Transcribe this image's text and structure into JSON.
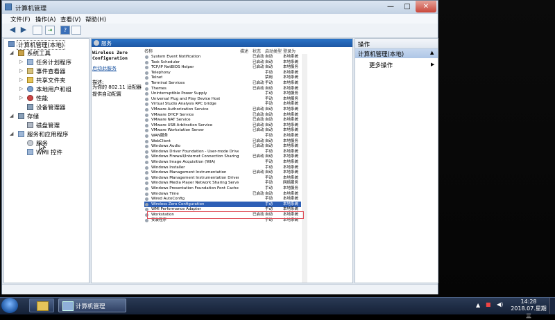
{
  "window": {
    "title": "计算机管理",
    "minimize": "—",
    "maximize": "□",
    "close": "✕"
  },
  "menu": [
    "文件(F)",
    "操作(A)",
    "查看(V)",
    "帮助(H)"
  ],
  "tree": {
    "root": "计算机管理(本地)",
    "system_tools": "系统工具",
    "items": [
      "任务计划程序",
      "事件查看器",
      "共享文件夹",
      "本地用户和组",
      "性能",
      "设备管理器"
    ],
    "storage": "存储",
    "disk": "磁盘管理",
    "services_apps": "服务和应用程序",
    "services": "服务",
    "wmi": "WMI 控件"
  },
  "center": {
    "header": "服务",
    "service_name": "Wireless Zero Configuration",
    "stop_link": "启动此服务",
    "desc_label": "描述:",
    "desc_text": "为你的 802.11 适配器提供自动配置"
  },
  "columns": [
    "名称",
    "描述",
    "状态",
    "启动类型",
    "登录为"
  ],
  "services": [
    [
      "System Event Notification",
      "",
      "已启动",
      "自动",
      "本地系统"
    ],
    [
      "Task Scheduler",
      "",
      "已启动",
      "自动",
      "本地系统"
    ],
    [
      "TCP/IP NetBIOS Helper",
      "",
      "已启动",
      "自动",
      "本地服务"
    ],
    [
      "Telephony",
      "",
      "",
      "手动",
      "本地系统"
    ],
    [
      "Telnet",
      "",
      "",
      "禁用",
      "本地系统"
    ],
    [
      "Terminal Services",
      "",
      "已启动",
      "手动",
      "本地系统"
    ],
    [
      "Themes",
      "",
      "已启动",
      "自动",
      "本地系统"
    ],
    [
      "Uninterruptible Power Supply",
      "",
      "",
      "手动",
      "本地服务"
    ],
    [
      "Universal Plug and Play Device Host",
      "",
      "",
      "手动",
      "本地服务"
    ],
    [
      "Virtual Studio Analysis RPC bridge",
      "",
      "",
      "手动",
      "本地系统"
    ],
    [
      "VMware Authorization Service",
      "",
      "已启动",
      "自动",
      "本地系统"
    ],
    [
      "VMware DHCP Service",
      "",
      "已启动",
      "自动",
      "本地系统"
    ],
    [
      "VMware NAT Service",
      "",
      "已启动",
      "自动",
      "本地系统"
    ],
    [
      "VMware USB Arbitration Service",
      "",
      "已启动",
      "自动",
      "本地系统"
    ],
    [
      "VMware Workstation Server",
      "",
      "已启动",
      "自动",
      "本地系统"
    ],
    [
      "WAN服务",
      "",
      "",
      "手动",
      "本地系统"
    ],
    [
      "WebClient",
      "",
      "已启动",
      "自动",
      "本地服务"
    ],
    [
      "Windows Audio",
      "",
      "已启动",
      "自动",
      "本地系统"
    ],
    [
      "Windows Driver Foundation - User-mode Driver Framework",
      "",
      "",
      "手动",
      "本地系统"
    ],
    [
      "Windows Firewall/Internet Connection Sharing (ICS)",
      "",
      "已启动",
      "自动",
      "本地系统"
    ],
    [
      "Windows Image Acquisition (WIA)",
      "",
      "",
      "手动",
      "本地系统"
    ],
    [
      "Windows Installer",
      "",
      "",
      "手动",
      "本地系统"
    ],
    [
      "Windows Management Instrumentation",
      "",
      "已启动",
      "自动",
      "本地系统"
    ],
    [
      "Windows Management Instrumentation Driver Extensions",
      "",
      "",
      "手动",
      "本地系统"
    ],
    [
      "Windows Media Player Network Sharing Service",
      "",
      "",
      "手动",
      "网络服务"
    ],
    [
      "Windows Presentation Foundation Font Cache 3.0.0.0",
      "",
      "",
      "手动",
      "本地服务"
    ],
    [
      "Windows Time",
      "",
      "已启动",
      "自动",
      "本地系统"
    ],
    [
      "Wired AutoConfig",
      "",
      "",
      "手动",
      "本地系统"
    ],
    [
      "Wireless Zero Configuration",
      "",
      "",
      "手动",
      "本地系统"
    ],
    [
      "WMI Performance Adapter",
      "",
      "",
      "手动",
      "本地系统"
    ],
    [
      "Workstation",
      "",
      "已启动",
      "自动",
      "本地系统"
    ],
    [
      "安装程序",
      "",
      "",
      "手动",
      "本地系统"
    ]
  ],
  "selected_index": 28,
  "actions": {
    "header": "操作",
    "sub": "计算机管理(本地)",
    "more": "更多操作",
    "arrow_up": "▲",
    "arrow_right": "▶"
  },
  "taskbar": {
    "task": "计算机管理",
    "time": "14:28",
    "date": "2018.07.星期三"
  },
  "colors": {
    "accent": "#1d56a3",
    "highlight": "#e0505a"
  }
}
